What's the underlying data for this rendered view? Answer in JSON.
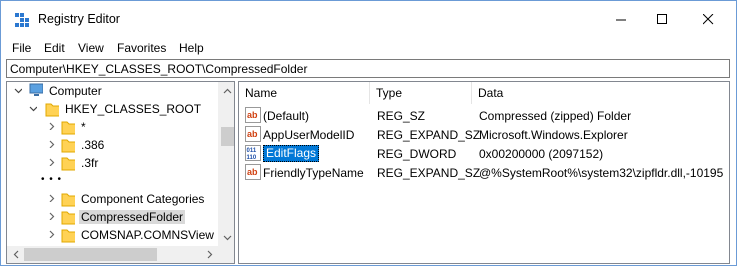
{
  "window": {
    "title": "Registry Editor",
    "colors": {
      "accent": "#0078d7",
      "folder": "#ffd255",
      "string_icon": "#d04010",
      "binary_icon": "#1e4fa8"
    }
  },
  "menu": [
    "File",
    "Edit",
    "View",
    "Favorites",
    "Help"
  ],
  "address": "Computer\\HKEY_CLASSES_ROOT\\CompressedFolder",
  "tree": {
    "root": "Computer",
    "hive": "HKEY_CLASSES_ROOT",
    "items": [
      "*",
      ".386",
      ".3fr"
    ],
    "ellipsis": "• • •",
    "items2": [
      "Component Categories",
      "CompressedFolder",
      "COMSNAP.COMNSView"
    ]
  },
  "list": {
    "headers": {
      "name": "Name",
      "type": "Type",
      "data": "Data"
    },
    "rows": [
      {
        "icon": "string-value-icon",
        "name": "(Default)",
        "type": "REG_SZ",
        "data": "Compressed (zipped) Folder"
      },
      {
        "icon": "string-value-icon",
        "name": "AppUserModelID",
        "type": "REG_EXPAND_SZ",
        "data": "Microsoft.Windows.Explorer"
      },
      {
        "icon": "binary-value-icon",
        "name": "EditFlags",
        "type": "REG_DWORD",
        "data": "0x00200000 (2097152)"
      },
      {
        "icon": "string-value-icon",
        "name": "FriendlyTypeName",
        "type": "REG_EXPAND_SZ",
        "data": "@%SystemRoot%\\system32\\zipfldr.dll,-10195"
      }
    ]
  }
}
